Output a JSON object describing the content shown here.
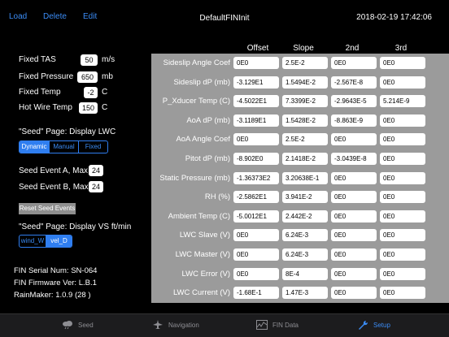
{
  "header": {
    "load_label": "Load",
    "delete_label": "Delete",
    "edit_label": "Edit",
    "title": "DefaultFINInit",
    "datetime": "2018-02-19 17:42:06"
  },
  "settings": {
    "fixed_tas": {
      "label": "Fixed TAS",
      "value": "50",
      "unit": "m/s"
    },
    "fixed_pressure": {
      "label": "Fixed Pressure",
      "value": "650",
      "unit": "mb"
    },
    "fixed_temp": {
      "label": "Fixed Temp",
      "value": "-2",
      "unit": "C"
    },
    "hot_wire_temp": {
      "label": "Hot Wire Temp",
      "value": "150",
      "unit": "C"
    },
    "seed_lwc": {
      "label": "\"Seed\" Page: Display LWC",
      "options": [
        "Dynamic",
        "Manual",
        "Fixed"
      ],
      "selected": "Dynamic"
    },
    "seed_event_a": {
      "label": "Seed Event A, Max",
      "value": "24"
    },
    "seed_event_b": {
      "label": "Seed Event B, Max",
      "value": "24"
    },
    "reset_label": "Reset Seed Events",
    "seed_vs": {
      "label": "\"Seed\" Page: Display VS ft/min",
      "options": [
        "wind_W",
        "vel_D"
      ],
      "selected": "vel_D"
    },
    "info": {
      "serial": "FIN Serial Num: SN-064",
      "firmware": "FIN Firmware Ver: L.B.1",
      "rainmaker": "RainMaker: 1.0.9 (28 )"
    }
  },
  "table": {
    "columns": [
      "Offset",
      "Slope",
      "2nd",
      "3rd"
    ],
    "rows": [
      {
        "label": "Sideslip Angle Coef",
        "values": [
          "0E0",
          "2.5E-2",
          "0E0",
          "0E0"
        ]
      },
      {
        "label": "Sideslip dP (mb)",
        "values": [
          "-3.129E1",
          "1.5494E-2",
          "-2.567E-8",
          "0E0"
        ]
      },
      {
        "label": "P_Xducer Temp (C)",
        "values": [
          "-4.5022E1",
          "7.3399E-2",
          "-2.9643E-5",
          "5.214E-9"
        ]
      },
      {
        "label": "AoA dP (mb)",
        "values": [
          "-3.1189E1",
          "1.5428E-2",
          "-8.863E-9",
          "0E0"
        ]
      },
      {
        "label": "AoA Angle Coef",
        "values": [
          "0E0",
          "2.5E-2",
          "0E0",
          "0E0"
        ]
      },
      {
        "label": "Pitot dP (mb)",
        "values": [
          "-8.902E0",
          "2.1418E-2",
          "-3.0439E-8",
          "0E0"
        ]
      },
      {
        "label": "Static Pressure (mb)",
        "values": [
          "-1.36373E2",
          "3.20638E-1",
          "0E0",
          "0E0"
        ]
      },
      {
        "label": "RH (%)",
        "values": [
          "-2.5862E1",
          "3.941E-2",
          "0E0",
          "0E0"
        ]
      },
      {
        "label": "Ambient Temp (C)",
        "values": [
          "-5.0012E1",
          "2.442E-2",
          "0E0",
          "0E0"
        ]
      },
      {
        "label": "LWC Slave (V)",
        "values": [
          "0E0",
          "6.24E-3",
          "0E0",
          "0E0"
        ]
      },
      {
        "label": "LWC Master (V)",
        "values": [
          "0E0",
          "6.24E-3",
          "0E0",
          "0E0"
        ]
      },
      {
        "label": "LWC Error (V)",
        "values": [
          "0E0",
          "8E-4",
          "0E0",
          "0E0"
        ]
      },
      {
        "label": "LWC Current (V)",
        "values": [
          "-1.68E-1",
          "1.47E-3",
          "0E0",
          "0E0"
        ]
      }
    ]
  },
  "tabs": [
    {
      "label": "Seed",
      "icon": "cloud-rain-icon"
    },
    {
      "label": "Navigation",
      "icon": "airplane-icon"
    },
    {
      "label": "FIN Data",
      "icon": "chart-icon"
    },
    {
      "label": "Setup",
      "icon": "wrench-icon",
      "active": true
    }
  ],
  "colors": {
    "accent": "#2f7ef0",
    "panel": "#9b9b9b",
    "background": "#000000",
    "tabbar": "#1c1c1e"
  }
}
